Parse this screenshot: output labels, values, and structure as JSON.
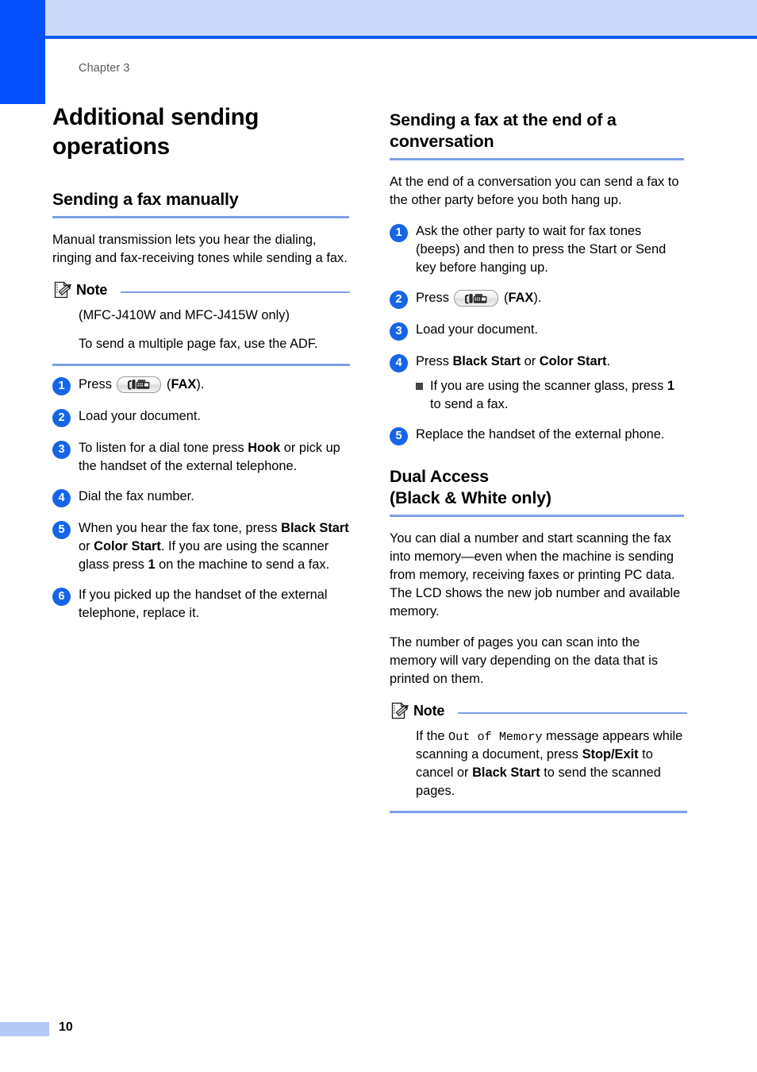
{
  "page": {
    "chapter_label": "Chapter 3",
    "page_number": "10",
    "title": "Additional sending operations"
  },
  "colors": {
    "left_bar_blue": "#0550fc",
    "header_band_blue": "#cdd9fb",
    "header_rule_blue": "#0a5bff",
    "rule_blue": "#7e9fe8",
    "step_circle_blue": "#1565e6",
    "chapter_gray": "#5a5a5a",
    "footer_bar_blue": "#b4c9f7",
    "bullet_gray": "#444444"
  },
  "left_column": {
    "section_title": "Sending a fax manually",
    "intro": "Manual transmission lets you hear the dialing, ringing and fax-receiving tones while sending a fax.",
    "note": {
      "title": "Note",
      "icon": "note-pencil-icon",
      "lines": [
        "(MFC-J410W and MFC-J415W only)",
        "To send a multiple page fax, use the ADF."
      ]
    },
    "steps": [
      {
        "num": "1",
        "parts": [
          {
            "type": "text",
            "value": "Press "
          },
          {
            "type": "faxkey"
          },
          {
            "type": "text",
            "value": " ("
          },
          {
            "type": "bold",
            "value": "FAX"
          },
          {
            "type": "text",
            "value": ")."
          }
        ]
      },
      {
        "num": "2",
        "parts": [
          {
            "type": "text",
            "value": "Load your document."
          }
        ]
      },
      {
        "num": "3",
        "parts": [
          {
            "type": "text",
            "value": "To listen for a dial tone press "
          },
          {
            "type": "bold",
            "value": "Hook"
          },
          {
            "type": "text",
            "value": " or pick up the handset of the external telephone."
          }
        ]
      },
      {
        "num": "4",
        "parts": [
          {
            "type": "text",
            "value": "Dial the fax number."
          }
        ]
      },
      {
        "num": "5",
        "parts": [
          {
            "type": "text",
            "value": "When you hear the fax tone, press "
          },
          {
            "type": "bold",
            "value": "Black Start"
          },
          {
            "type": "text",
            "value": " or "
          },
          {
            "type": "bold",
            "value": "Color Start"
          },
          {
            "type": "text",
            "value": ". If you are using the scanner glass press "
          },
          {
            "type": "bold",
            "value": "1"
          },
          {
            "type": "text",
            "value": " on the machine to send a fax."
          }
        ]
      },
      {
        "num": "6",
        "parts": [
          {
            "type": "text",
            "value": "If you picked up the handset of the external telephone, replace it."
          }
        ]
      }
    ]
  },
  "right_column": {
    "section1_title": "Sending a fax at the end of a conversation",
    "section1_intro": "At the end of a conversation you can send a fax to the other party before you both hang up.",
    "section1_steps": [
      {
        "num": "1",
        "parts": [
          {
            "type": "text",
            "value": "Ask the other party to wait for fax tones (beeps) and then to press the Start or Send key before hanging up."
          }
        ]
      },
      {
        "num": "2",
        "parts": [
          {
            "type": "text",
            "value": "Press "
          },
          {
            "type": "faxkey"
          },
          {
            "type": "text",
            "value": " ("
          },
          {
            "type": "bold",
            "value": "FAX"
          },
          {
            "type": "text",
            "value": ")."
          }
        ]
      },
      {
        "num": "3",
        "parts": [
          {
            "type": "text",
            "value": "Load your document."
          }
        ]
      },
      {
        "num": "4",
        "parts": [
          {
            "type": "text",
            "value": "Press "
          },
          {
            "type": "bold",
            "value": "Black Start"
          },
          {
            "type": "text",
            "value": " or "
          },
          {
            "type": "bold",
            "value": "Color Start"
          },
          {
            "type": "text",
            "value": "."
          }
        ],
        "subbullets": [
          [
            {
              "type": "text",
              "value": "If you are using the scanner glass, press "
            },
            {
              "type": "bold",
              "value": "1"
            },
            {
              "type": "text",
              "value": " to send a fax."
            }
          ]
        ]
      },
      {
        "num": "5",
        "parts": [
          {
            "type": "text",
            "value": "Replace the handset of the external phone."
          }
        ]
      }
    ],
    "section2_title": "Dual Access\n(Black & White only)",
    "section2_title_line1": "Dual Access",
    "section2_title_line2": "(Black & White only)",
    "section2_paragraphs": [
      "You can dial a number and start scanning the fax into memory—even when the machine is sending from memory, receiving faxes or printing PC data. The LCD shows the new job number and available memory.",
      "The number of pages you can scan into the memory will vary depending on the data that is printed on them."
    ],
    "note": {
      "title": "Note",
      "icon": "note-pencil-icon",
      "parts": [
        {
          "type": "text",
          "value": "If the "
        },
        {
          "type": "mono",
          "value": "Out of Memory"
        },
        {
          "type": "text",
          "value": " message appears while scanning a document, press "
        },
        {
          "type": "bold",
          "value": "Stop/Exit"
        },
        {
          "type": "text",
          "value": " to cancel or "
        },
        {
          "type": "bold",
          "value": "Black Start"
        },
        {
          "type": "text",
          "value": " to send the scanned pages."
        }
      ]
    }
  }
}
